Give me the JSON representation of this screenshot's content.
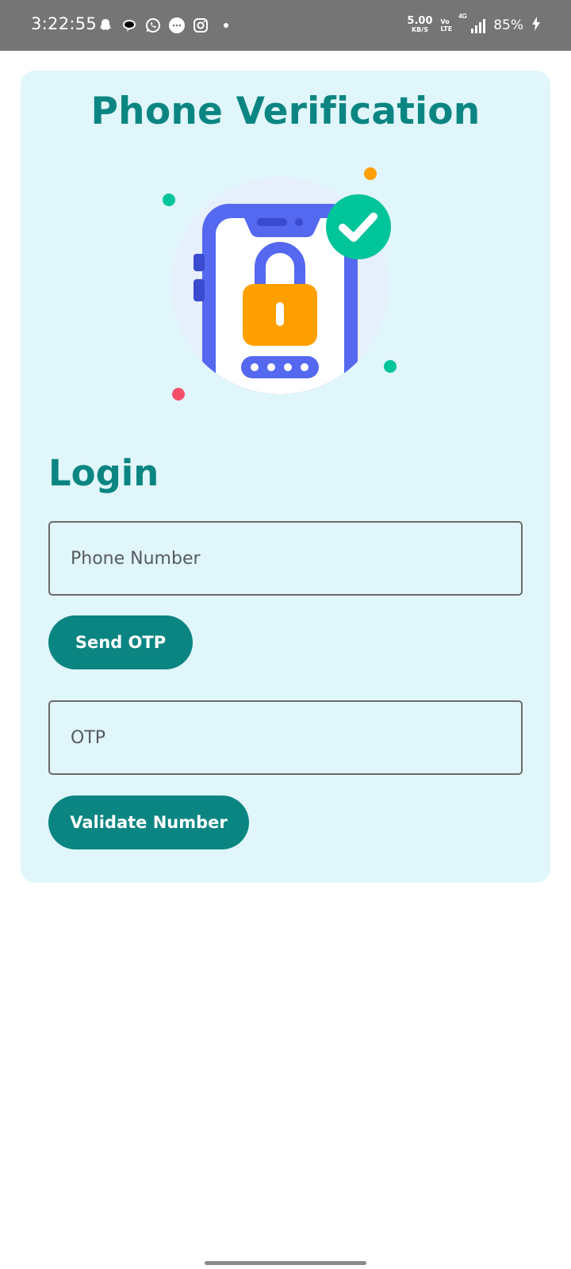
{
  "status_bar": {
    "time": "3:22:55",
    "notification_icons": [
      "snapchat-icon",
      "chat-bubble-icon",
      "whatsapp-icon",
      "messages-icon",
      "instagram-icon"
    ],
    "speed_value": "5.00",
    "speed_unit": "KB/S",
    "volte_top": "Vo",
    "volte_bottom": "LTE",
    "network": "4G",
    "battery": "85%"
  },
  "screen": {
    "title": "Phone Verification",
    "login_heading": "Login",
    "phone_field": {
      "placeholder": "Phone Number",
      "value": ""
    },
    "send_otp_label": "Send OTP",
    "otp_field": {
      "placeholder": "OTP",
      "value": ""
    },
    "validate_label": "Validate Number"
  },
  "colors": {
    "accent": "#0b8582",
    "card_background": "#e0f6fa",
    "phone_blue": "#5468f0",
    "lock_orange": "#ffa000",
    "check_green": "#00c49a"
  }
}
